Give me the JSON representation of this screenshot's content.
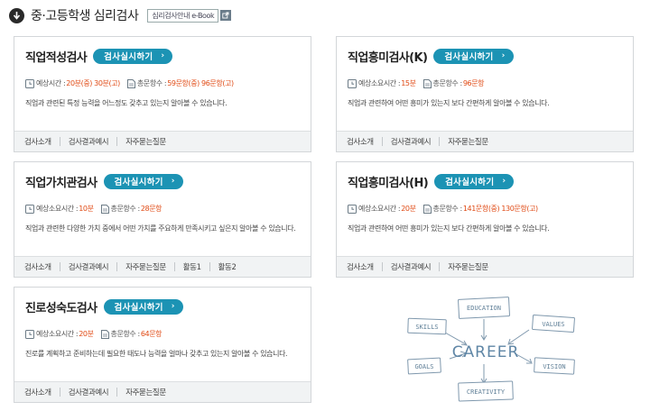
{
  "header": {
    "title": "중·고등학생 심리검사",
    "ebook_label": "심리검사안내 e-Book"
  },
  "labels": {
    "time_label_long": "예상시간 :",
    "time_label": "예상소요시간 :",
    "count_label": "총문항수 :",
    "start_button": "검사실시하기"
  },
  "cards": [
    {
      "title": "직업적성검사",
      "time_label": "예상시간 :",
      "time": "20분(중) 30분(고)",
      "count": "59문항(중) 96문항(고)",
      "desc": "직업과 관련된 특정 능력을 어느정도 갖추고 있는지 알아볼 수 있습니다.",
      "links": [
        "검사소개",
        "검사결과예시",
        "자주묻는질문"
      ]
    },
    {
      "title": "직업흥미검사(K)",
      "time_label": "예상소요시간 :",
      "time": "15분",
      "count": "96문항",
      "desc": "직업과 관련하여 어떤 흥미가 있는지 보다 간편하게 알아볼 수 있습니다.",
      "links": [
        "검사소개",
        "검사결과예시",
        "자주묻는질문"
      ]
    },
    {
      "title": "직업가치관검사",
      "time_label": "예상소요시간 :",
      "time": "10분",
      "count": "28문항",
      "desc": "직업과 관련한 다양한 가치 중에서 어떤 가치를 주요하게 만족시키고 싶은지 알아볼 수 있습니다.",
      "links": [
        "검사소개",
        "검사결과예시",
        "자주묻는질문",
        "활동1",
        "활동2"
      ]
    },
    {
      "title": "직업흥미검사(H)",
      "time_label": "예상소요시간 :",
      "time": "20분",
      "count": "141문항(중) 130문항(고)",
      "desc": "직업과 관련하여 어떤 흥미가 있는지 보다 간편하게 알아볼 수 있습니다.",
      "links": [
        "검사소개",
        "검사결과예시",
        "자주묻는질문"
      ]
    },
    {
      "title": "진로성숙도검사",
      "time_label": "예상소요시간 :",
      "time": "20분",
      "count": "64문항",
      "desc": "진로를 계획하고 준비하는데 필요한 태도나 능력을 얼마나 갖추고 있는지 알아볼 수 있습니다.",
      "links": [
        "검사소개",
        "검사결과예시",
        "자주묻는질문"
      ]
    }
  ],
  "career_illustration": {
    "center": "CAREER",
    "nodes": [
      "EDUCATION",
      "SKILLS",
      "VALUES",
      "GOALS",
      "VISION",
      "CREATIVITY"
    ]
  },
  "colors": {
    "accent": "#1c93b4",
    "highlight": "#e04a14",
    "footer_bg": "#f1f3f4"
  }
}
